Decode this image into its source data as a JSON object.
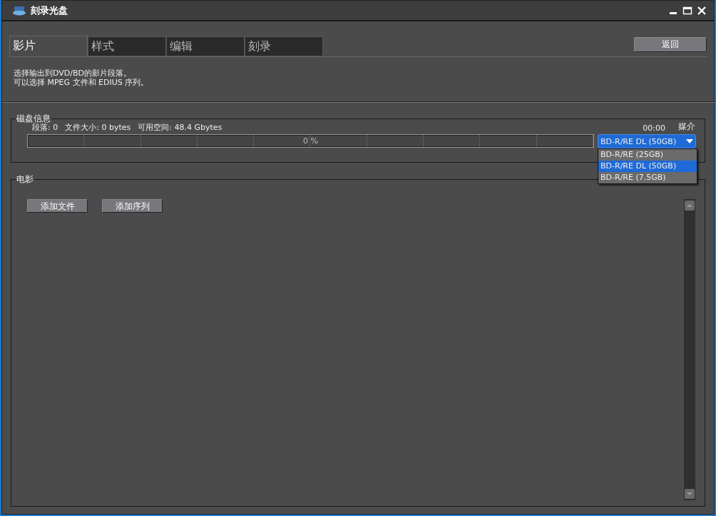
{
  "window": {
    "title": "刻录光盘"
  },
  "tabs": [
    {
      "label": "影片",
      "selected": true
    },
    {
      "label": "样式",
      "selected": false
    },
    {
      "label": "编辑",
      "selected": false
    },
    {
      "label": "刻录",
      "selected": false
    }
  ],
  "back_button": "返回",
  "description": [
    "选择输出到DVD/BD的影片段落。",
    "可以选择 MPEG 文件和 EDIUS 序列。"
  ],
  "disc_info": {
    "title": "磁盘信息",
    "segments": "段落: 0",
    "file_size": "文件大小: 0 bytes",
    "free_space": "可用空间: 48.4 Gbytes",
    "duration": "00:00",
    "progress": {
      "reading": "0 %"
    },
    "media_label": "媒介",
    "media": {
      "value": "BD-R/RE DL (50GB)",
      "expanded": true,
      "options": [
        {
          "label": "BD-R/RE (25GB)",
          "selected": false
        },
        {
          "label": "BD-R/RE DL (50GB)",
          "selected": true
        },
        {
          "label": "BD-R/RE (7.5GB)",
          "selected": false
        }
      ]
    }
  },
  "movie": {
    "title": "电影",
    "buttons": [
      "添加文件",
      "添加序列"
    ]
  }
}
